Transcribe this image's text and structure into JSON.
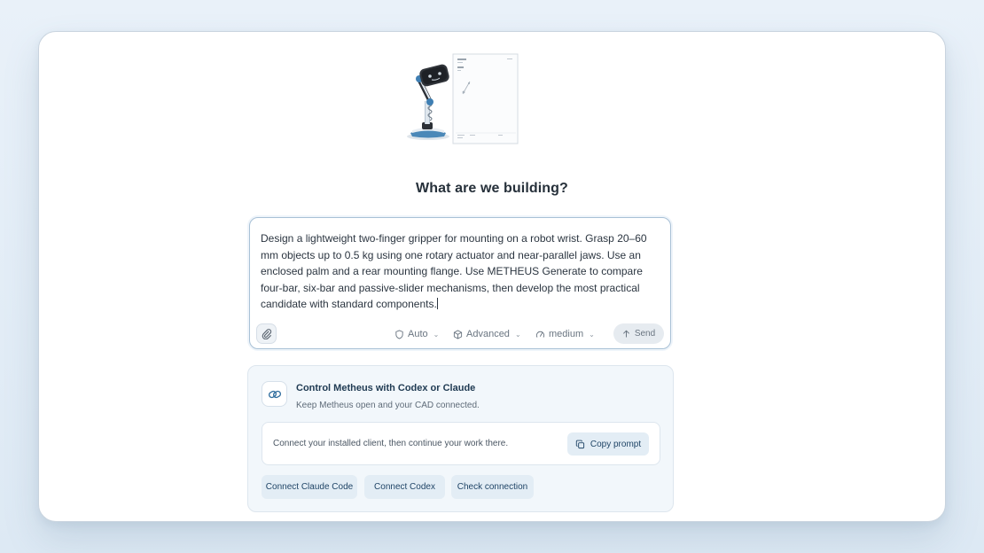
{
  "hero": {
    "image": "robot-arm-with-drawing-sheet"
  },
  "main": {
    "title": "What are we building?"
  },
  "composer": {
    "prompt": "Design a lightweight two-finger gripper for mounting on a robot wrist. Grasp 20–60 mm objects up to 0.5 kg using one rotary actuator and near-parallel jaws. Use an enclosed palm and a rear mounting flange. Use METHEUS Generate to compare four-bar, six-bar and passive-slider mechanisms, then develop the most practical candidate with standard components.",
    "attach_icon": "paperclip-icon",
    "mode": {
      "icon": "shield-icon",
      "label": "Auto"
    },
    "model": {
      "icon": "cube-icon",
      "label": "Advanced"
    },
    "effort": {
      "icon": "gauge-icon",
      "label": "medium"
    },
    "send": {
      "icon": "arrow-up-icon",
      "label": "Send"
    }
  },
  "integration": {
    "icon": "link-icon",
    "title": "Control Metheus with Codex or Claude",
    "subtitle": "Keep Metheus open and your CAD connected.",
    "instruction": "Connect your installed client, then continue your work there.",
    "copy_prompt": {
      "icon": "copy-icon",
      "label": "Copy prompt"
    },
    "buttons": [
      "Connect Claude Code",
      "Connect Codex",
      "Check connection"
    ]
  }
}
